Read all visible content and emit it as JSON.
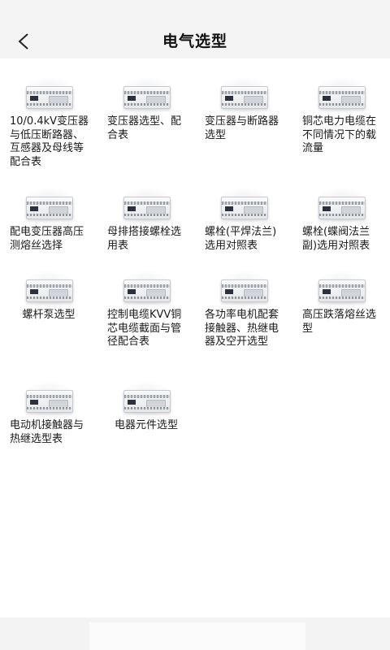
{
  "header": {
    "title": "电气选型",
    "back_icon": "chevron-left-icon"
  },
  "items": [
    {
      "label": "10/0.4kV变压器与低压断路器、互感器及母线等配合表",
      "icon": "plc-module-icon"
    },
    {
      "label": "变压器选型、配合表",
      "icon": "plc-module-icon"
    },
    {
      "label": "变压器与断路器选型",
      "icon": "plc-module-icon"
    },
    {
      "label": "铜芯电力电缆在不同情况下的载流量",
      "icon": "plc-module-icon"
    },
    {
      "label": "配电变压器高压测熔丝选择",
      "icon": "plc-module-icon"
    },
    {
      "label": "母排搭接螺栓选用表",
      "icon": "plc-module-icon"
    },
    {
      "label": "螺栓(平焊法兰)选用对照表",
      "icon": "plc-module-icon"
    },
    {
      "label": "螺栓(蝶阀法兰副)选用对照表",
      "icon": "plc-module-icon"
    },
    {
      "label": "螺杆泵选型",
      "icon": "plc-module-icon"
    },
    {
      "label": "控制电缆KVV铜芯电缆截面与管径配合表",
      "icon": "plc-module-icon"
    },
    {
      "label": "各功率电机配套接触器、热继电器及空开选型",
      "icon": "plc-module-icon"
    },
    {
      "label": "高压跌落熔丝选型",
      "icon": "plc-module-icon"
    },
    {
      "label": "电动机接触器与热继选型表",
      "icon": "plc-module-icon"
    },
    {
      "label": "电器元件选型",
      "icon": "plc-module-icon"
    }
  ]
}
